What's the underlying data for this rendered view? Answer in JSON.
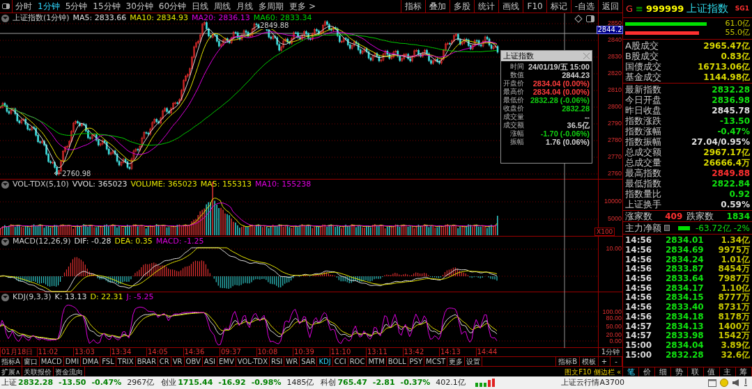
{
  "toolbar": {
    "period_tabs": [
      {
        "label": "分时",
        "selected": false
      },
      {
        "label": "1分钟",
        "selected": true
      },
      {
        "label": "5分钟",
        "selected": false
      },
      {
        "label": "15分钟",
        "selected": false
      },
      {
        "label": "30分钟",
        "selected": false
      },
      {
        "label": "60分钟",
        "selected": false
      },
      {
        "label": "日线",
        "selected": false
      },
      {
        "label": "周线",
        "selected": false
      },
      {
        "label": "月线",
        "selected": false
      },
      {
        "label": "多周期",
        "selected": false
      },
      {
        "label": "更多 >",
        "selected": false
      }
    ],
    "buttons": [
      "指标",
      "叠加",
      "多股",
      "统计",
      "画线",
      "F10",
      "标记",
      "-自选",
      "返回"
    ]
  },
  "main_chart": {
    "title": "上证指数(1分钟)",
    "legend": [
      {
        "label": "MA5: 2833.66",
        "color": "#e0e0e0"
      },
      {
        "label": "MA10: 2834.93",
        "color": "#e8e800"
      },
      {
        "label": "MA20: 2836.13",
        "color": "#e000e0"
      },
      {
        "label": "MA60: 2833.34",
        "color": "#00d000"
      }
    ],
    "high_label": "2849.88",
    "low_label": "2760.98",
    "current_price": "2844.2",
    "axis": [
      "2850",
      "2840",
      "2830",
      "2820",
      "2810",
      "2800",
      "2790",
      "2780",
      "2770",
      "2760"
    ]
  },
  "tooltip": {
    "title": "上证指数",
    "rows": [
      {
        "label": "时间",
        "value": "24/01/19/五 15:00",
        "color": "#d0d0d0"
      },
      {
        "label": "数值",
        "value": "2844.23",
        "color": "#d0d0d0"
      },
      {
        "label": "开盘价",
        "value": "2834.04 (0.00%)",
        "color": "#ff3c3c"
      },
      {
        "label": "最高价",
        "value": "2834.04 (0.00%)",
        "color": "#ff3c3c"
      },
      {
        "label": "最低价",
        "value": "2832.28 (-0.06%)",
        "color": "#10d010"
      },
      {
        "label": "收盘价",
        "value": "2832.28",
        "color": "#10d010"
      },
      {
        "label": "成交量",
        "value": "--",
        "color": "#d0d0d0"
      },
      {
        "label": "成交额",
        "value": "36.5亿",
        "color": "#d0d0d0"
      },
      {
        "label": "涨幅",
        "value": "-1.70 (-0.06%)",
        "color": "#10d010"
      },
      {
        "label": "振幅",
        "value": "1.76 (0.06%)",
        "color": "#d0d0d0"
      }
    ]
  },
  "volume_pane": {
    "legend": [
      {
        "label": "VOL-TDX(5,10)",
        "color": "#d0d0d0"
      },
      {
        "label": "VVOL: 365023",
        "color": "#e0e0e0"
      },
      {
        "label": "VOLUME: 365023",
        "color": "#e8e800"
      },
      {
        "label": "MA5: 155313",
        "color": "#e8e800"
      },
      {
        "label": "MA10: 155238",
        "color": "#e000e0"
      }
    ],
    "axis": [
      "10000",
      "5000"
    ],
    "unit": "X100"
  },
  "macd_pane": {
    "legend": [
      {
        "label": "MACD(12,26,9)",
        "color": "#d0d0d0"
      },
      {
        "label": "DIF: -0.28",
        "color": "#e0e0e0"
      },
      {
        "label": "DEA: 0.35",
        "color": "#e8e800"
      },
      {
        "label": "MACD: -1.25",
        "color": "#e000e0"
      }
    ],
    "axis": [
      "10.00"
    ]
  },
  "kdj_pane": {
    "legend": [
      {
        "label": "KDJ(9,3,3)",
        "color": "#d0d0d0"
      },
      {
        "label": "K: 13.13",
        "color": "#e0e0e0"
      },
      {
        "label": "D: 22.31",
        "color": "#e8e800"
      },
      {
        "label": "J: -5.25",
        "color": "#e000e0"
      }
    ],
    "axis": [
      "100.00",
      "80.00",
      "50.00",
      "20.00",
      "0.00"
    ]
  },
  "time_axis": [
    "01月18日",
    "11:02",
    "13:03",
    "13:34",
    "14:05",
    "14:36",
    "09:37",
    "10:08",
    "10:39",
    "11:10",
    "13:11",
    "13:42",
    "14:13",
    "14:44"
  ],
  "period_label": "1分钟",
  "zoom_buttons": [
    "+",
    "-"
  ],
  "indicator_tabs": [
    {
      "label": "指标A",
      "selected": false
    },
    {
      "label": "窗口",
      "selected": false
    },
    {
      "label": "MACD",
      "selected": false
    },
    {
      "label": "DMI",
      "selected": false
    },
    {
      "label": "DMA",
      "selected": false
    },
    {
      "label": "FSL",
      "selected": false
    },
    {
      "label": "TRIX",
      "selected": false
    },
    {
      "label": "BRAR",
      "selected": false
    },
    {
      "label": "CR",
      "selected": false
    },
    {
      "label": "VR",
      "selected": false
    },
    {
      "label": "OBV",
      "selected": false
    },
    {
      "label": "ASI",
      "selected": false
    },
    {
      "label": "EMV",
      "selected": false
    },
    {
      "label": "VOL-TDX",
      "selected": false
    },
    {
      "label": "RSI",
      "selected": false
    },
    {
      "label": "WR",
      "selected": false
    },
    {
      "label": "SAR",
      "selected": false
    },
    {
      "label": "KDJ",
      "selected": true
    },
    {
      "label": "CCI",
      "selected": false
    },
    {
      "label": "ROC",
      "selected": false
    },
    {
      "label": "MTM",
      "selected": false
    },
    {
      "label": "BOLL",
      "selected": false
    },
    {
      "label": "PSY",
      "selected": false
    },
    {
      "label": "MCST",
      "selected": false
    },
    {
      "label": "更多",
      "selected": false
    },
    {
      "label": "设置",
      "selected": false
    }
  ],
  "right_tabs": [
    "指标B",
    "模板"
  ],
  "extension_tabs": [
    "扩展∧",
    "关联报价",
    "资金流向"
  ],
  "side_links": [
    "图文F10",
    "侧边栏 «"
  ],
  "quote_panel": {
    "header": {
      "prefix": "G",
      "menu": "≡",
      "code": "999999",
      "name": "上证指数",
      "tag": "SG1"
    },
    "flow_bars": [
      {
        "value": "61.0亿",
        "color": "#00e000"
      },
      {
        "value": "55.0亿",
        "color": "#ff3030"
      }
    ],
    "turnover": [
      {
        "label": "A股成交",
        "value": "2965.47亿",
        "color": "#d8d800"
      },
      {
        "label": "B股成交",
        "value": "0.83亿",
        "color": "#d8d800"
      },
      {
        "label": "国债成交",
        "value": "16713.06亿",
        "color": "#d8d800"
      },
      {
        "label": "基金成交",
        "value": "1144.98亿",
        "color": "#d8d800"
      }
    ],
    "stats": [
      {
        "label": "最新指数",
        "value": "2832.28",
        "color": "#10e010"
      },
      {
        "label": "今日开盘",
        "value": "2836.98",
        "color": "#10e010"
      },
      {
        "label": "昨日收盘",
        "value": "2845.78",
        "color": "#e0e0e0"
      },
      {
        "label": "指数涨跌",
        "value": "-13.50",
        "color": "#10e010"
      },
      {
        "label": "指数涨幅",
        "value": "-0.47%",
        "color": "#10e010"
      },
      {
        "label": "指数振幅",
        "value": "27.04/0.95%",
        "color": "#e0e0e0"
      },
      {
        "label": "总成交额",
        "value": "2967.17亿",
        "color": "#d8d800"
      },
      {
        "label": "总成交量",
        "value": "26666.4万",
        "color": "#d8d800"
      },
      {
        "label": "最高指数",
        "value": "2849.88",
        "color": "#ff3030"
      },
      {
        "label": "最低指数",
        "value": "2822.84",
        "color": "#10e010"
      },
      {
        "label": "指数量比",
        "value": "0.92",
        "color": "#10e010"
      },
      {
        "label": "上证换手",
        "value": "0.59%",
        "color": "#e0e0e0"
      }
    ],
    "breadth": {
      "up_label": "涨家数",
      "up_value": "409",
      "down_label": "跌家数",
      "down_value": "1834"
    },
    "net_flow": {
      "label": "主力净额",
      "value": "-63.72亿",
      "percent": "-2%"
    },
    "ticks": [
      {
        "time": "14:56",
        "price": "2834.01",
        "volume": "1.34亿"
      },
      {
        "time": "14:56",
        "price": "2834.69",
        "volume": "9975万"
      },
      {
        "time": "14:56",
        "price": "2834.24",
        "volume": "1.01亿"
      },
      {
        "time": "14:56",
        "price": "2833.87",
        "volume": "8454万"
      },
      {
        "time": "14:56",
        "price": "2833.64",
        "volume": "7987万"
      },
      {
        "time": "14:56",
        "price": "2834.17",
        "volume": "1.10亿"
      },
      {
        "time": "14:56",
        "price": "2834.15",
        "volume": "8777万"
      },
      {
        "time": "14:56",
        "price": "2833.40",
        "volume": "8731万"
      },
      {
        "time": "14:56",
        "price": "2834.18",
        "volume": "8178万"
      },
      {
        "time": "14:57",
        "price": "2834.13",
        "volume": "1400万"
      },
      {
        "time": "14:57",
        "price": "2833.98",
        "volume": "1542万"
      },
      {
        "time": "15:00",
        "price": "2834.04",
        "volume": "3.89亿"
      },
      {
        "time": "15:00",
        "price": "2832.28",
        "volume": "32.6亿"
      }
    ],
    "tabs": [
      {
        "label": "笔",
        "selected": true
      },
      {
        "label": "价",
        "selected": false
      },
      {
        "label": "细",
        "selected": false
      },
      {
        "label": "势",
        "selected": false
      },
      {
        "label": "联",
        "selected": false
      },
      {
        "label": "值",
        "selected": false
      },
      {
        "label": "主",
        "selected": false
      },
      {
        "label": "筹",
        "selected": false
      }
    ]
  },
  "status_bar": {
    "indices": [
      {
        "name": "上证",
        "price": "2832.28",
        "change": "-13.50",
        "percent": "-0.47%",
        "amount": "2967亿"
      },
      {
        "name": "创业",
        "price": "1715.44",
        "change": "-16.92",
        "percent": "-0.98%",
        "amount": "1485亿"
      },
      {
        "name": "科创",
        "price": "765.47",
        "change": "-2.81",
        "percent": "-0.37%",
        "amount": "402.1亿"
      }
    ],
    "right_text": "上证云行情A3700"
  }
}
